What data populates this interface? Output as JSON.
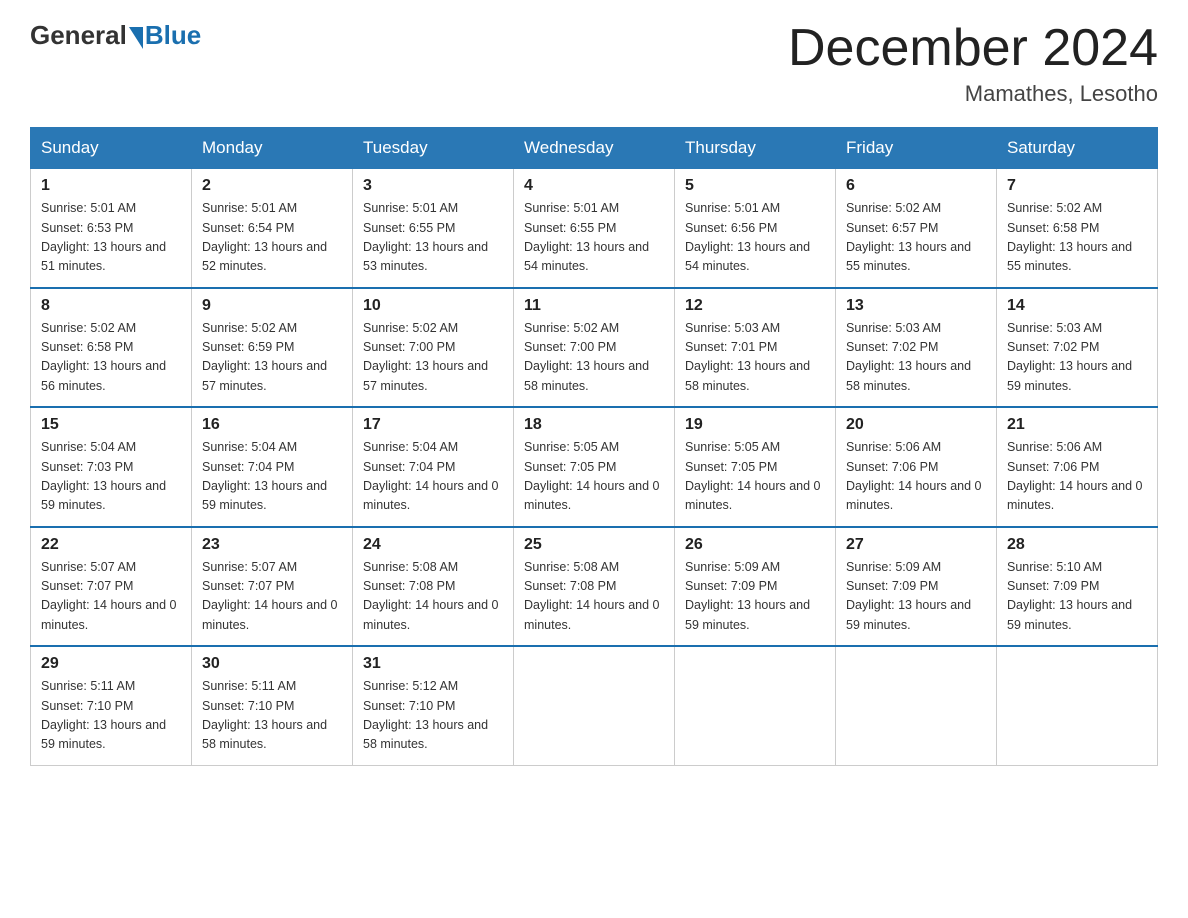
{
  "header": {
    "logo_general": "General",
    "logo_blue": "Blue",
    "month_title": "December 2024",
    "location": "Mamathes, Lesotho"
  },
  "days_of_week": [
    "Sunday",
    "Monday",
    "Tuesday",
    "Wednesday",
    "Thursday",
    "Friday",
    "Saturday"
  ],
  "weeks": [
    [
      {
        "day": 1,
        "sunrise": "5:01 AM",
        "sunset": "6:53 PM",
        "daylight": "13 hours and 51 minutes."
      },
      {
        "day": 2,
        "sunrise": "5:01 AM",
        "sunset": "6:54 PM",
        "daylight": "13 hours and 52 minutes."
      },
      {
        "day": 3,
        "sunrise": "5:01 AM",
        "sunset": "6:55 PM",
        "daylight": "13 hours and 53 minutes."
      },
      {
        "day": 4,
        "sunrise": "5:01 AM",
        "sunset": "6:55 PM",
        "daylight": "13 hours and 54 minutes."
      },
      {
        "day": 5,
        "sunrise": "5:01 AM",
        "sunset": "6:56 PM",
        "daylight": "13 hours and 54 minutes."
      },
      {
        "day": 6,
        "sunrise": "5:02 AM",
        "sunset": "6:57 PM",
        "daylight": "13 hours and 55 minutes."
      },
      {
        "day": 7,
        "sunrise": "5:02 AM",
        "sunset": "6:58 PM",
        "daylight": "13 hours and 55 minutes."
      }
    ],
    [
      {
        "day": 8,
        "sunrise": "5:02 AM",
        "sunset": "6:58 PM",
        "daylight": "13 hours and 56 minutes."
      },
      {
        "day": 9,
        "sunrise": "5:02 AM",
        "sunset": "6:59 PM",
        "daylight": "13 hours and 57 minutes."
      },
      {
        "day": 10,
        "sunrise": "5:02 AM",
        "sunset": "7:00 PM",
        "daylight": "13 hours and 57 minutes."
      },
      {
        "day": 11,
        "sunrise": "5:02 AM",
        "sunset": "7:00 PM",
        "daylight": "13 hours and 58 minutes."
      },
      {
        "day": 12,
        "sunrise": "5:03 AM",
        "sunset": "7:01 PM",
        "daylight": "13 hours and 58 minutes."
      },
      {
        "day": 13,
        "sunrise": "5:03 AM",
        "sunset": "7:02 PM",
        "daylight": "13 hours and 58 minutes."
      },
      {
        "day": 14,
        "sunrise": "5:03 AM",
        "sunset": "7:02 PM",
        "daylight": "13 hours and 59 minutes."
      }
    ],
    [
      {
        "day": 15,
        "sunrise": "5:04 AM",
        "sunset": "7:03 PM",
        "daylight": "13 hours and 59 minutes."
      },
      {
        "day": 16,
        "sunrise": "5:04 AM",
        "sunset": "7:04 PM",
        "daylight": "13 hours and 59 minutes."
      },
      {
        "day": 17,
        "sunrise": "5:04 AM",
        "sunset": "7:04 PM",
        "daylight": "14 hours and 0 minutes."
      },
      {
        "day": 18,
        "sunrise": "5:05 AM",
        "sunset": "7:05 PM",
        "daylight": "14 hours and 0 minutes."
      },
      {
        "day": 19,
        "sunrise": "5:05 AM",
        "sunset": "7:05 PM",
        "daylight": "14 hours and 0 minutes."
      },
      {
        "day": 20,
        "sunrise": "5:06 AM",
        "sunset": "7:06 PM",
        "daylight": "14 hours and 0 minutes."
      },
      {
        "day": 21,
        "sunrise": "5:06 AM",
        "sunset": "7:06 PM",
        "daylight": "14 hours and 0 minutes."
      }
    ],
    [
      {
        "day": 22,
        "sunrise": "5:07 AM",
        "sunset": "7:07 PM",
        "daylight": "14 hours and 0 minutes."
      },
      {
        "day": 23,
        "sunrise": "5:07 AM",
        "sunset": "7:07 PM",
        "daylight": "14 hours and 0 minutes."
      },
      {
        "day": 24,
        "sunrise": "5:08 AM",
        "sunset": "7:08 PM",
        "daylight": "14 hours and 0 minutes."
      },
      {
        "day": 25,
        "sunrise": "5:08 AM",
        "sunset": "7:08 PM",
        "daylight": "14 hours and 0 minutes."
      },
      {
        "day": 26,
        "sunrise": "5:09 AM",
        "sunset": "7:09 PM",
        "daylight": "13 hours and 59 minutes."
      },
      {
        "day": 27,
        "sunrise": "5:09 AM",
        "sunset": "7:09 PM",
        "daylight": "13 hours and 59 minutes."
      },
      {
        "day": 28,
        "sunrise": "5:10 AM",
        "sunset": "7:09 PM",
        "daylight": "13 hours and 59 minutes."
      }
    ],
    [
      {
        "day": 29,
        "sunrise": "5:11 AM",
        "sunset": "7:10 PM",
        "daylight": "13 hours and 59 minutes."
      },
      {
        "day": 30,
        "sunrise": "5:11 AM",
        "sunset": "7:10 PM",
        "daylight": "13 hours and 58 minutes."
      },
      {
        "day": 31,
        "sunrise": "5:12 AM",
        "sunset": "7:10 PM",
        "daylight": "13 hours and 58 minutes."
      },
      null,
      null,
      null,
      null
    ]
  ]
}
